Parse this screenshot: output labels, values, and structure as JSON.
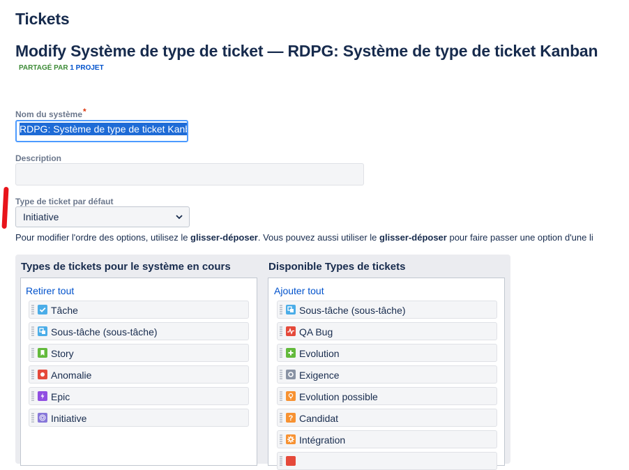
{
  "header": {
    "title": "Tickets",
    "modify_title": "Modify Système de type de ticket — RDPG: Système de type de ticket Kanban",
    "shared_prefix": "PARTAGÉ PAR",
    "shared_count": "1 PROJET"
  },
  "form": {
    "name_label": "Nom du système",
    "name_required": "*",
    "name_value": "RDPG: Système de type de ticket Kanb",
    "description_label": "Description",
    "description_value": "",
    "default_type_label": "Type de ticket par défaut",
    "default_type_selected": "Initiative"
  },
  "hint": {
    "part1": "Pour modifier l'ordre des options, utilisez le ",
    "bold1": "glisser-déposer",
    "part2": ". Vous pouvez aussi utiliser le ",
    "bold2": "glisser-déposer",
    "part3": " pour faire passer une option d'une li"
  },
  "current": {
    "title": "Types de tickets pour le système en cours",
    "action": "Retirer tout",
    "items": [
      {
        "label": "Tâche",
        "icon": "task-icon",
        "color": "#4bade8"
      },
      {
        "label": "Sous-tâche (sous-tâche)",
        "icon": "subtask-icon",
        "color": "#4bade8"
      },
      {
        "label": "Story",
        "icon": "story-icon",
        "color": "#63ba3c"
      },
      {
        "label": "Anomalie",
        "icon": "bug-icon",
        "color": "#e5493a"
      },
      {
        "label": "Epic",
        "icon": "epic-icon",
        "color": "#904ee2"
      },
      {
        "label": "Initiative",
        "icon": "initiative-icon",
        "color": "#8777d9"
      }
    ]
  },
  "available": {
    "title": "Disponible Types de tickets",
    "action": "Ajouter tout",
    "items": [
      {
        "label": "Sous-tâche (sous-tâche)",
        "icon": "subtask-icon",
        "color": "#4bade8"
      },
      {
        "label": "QA Bug",
        "icon": "qa-bug-icon",
        "color": "#e5493a"
      },
      {
        "label": "Evolution",
        "icon": "plus-icon",
        "color": "#63ba3c"
      },
      {
        "label": "Exigence",
        "icon": "requirement-icon",
        "color": "#8993a4"
      },
      {
        "label": "Evolution possible",
        "icon": "lightbulb-icon",
        "color": "#f79232"
      },
      {
        "label": "Candidat",
        "icon": "question-icon",
        "color": "#f79232"
      },
      {
        "label": "Intégration",
        "icon": "gear-icon",
        "color": "#f79232"
      },
      {
        "label": "",
        "icon": "partial-icon",
        "color": "#e5493a"
      }
    ]
  }
}
